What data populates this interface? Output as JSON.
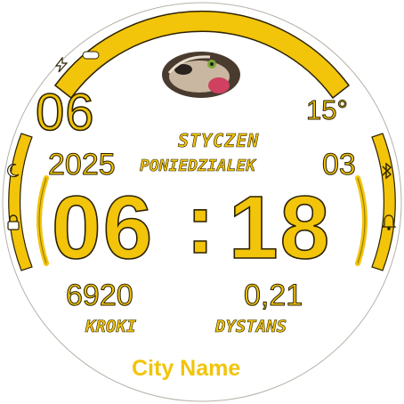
{
  "colors": {
    "accent": "#F2C40A",
    "outline": "#2b2200",
    "background": "#ffffff"
  },
  "date": {
    "day": "06",
    "year": "2025",
    "month_name": "STYCZEN",
    "weekday_name": "PONIEDZIALEK",
    "week_number": "03"
  },
  "weather": {
    "temperature": "15°"
  },
  "time": {
    "hours": "06",
    "separator": ":",
    "minutes": "18"
  },
  "activity": {
    "steps_value": "6920",
    "steps_label": "KROKI",
    "distance_value": "0,21",
    "distance_label": "DYSTANS"
  },
  "location": {
    "city": "City Name"
  },
  "icons": {
    "top_left": "charging-bolt-icon",
    "left_upper": "moon-icon",
    "left_lower": "lock-icon",
    "right_upper": "bluetooth-icon",
    "right_lower": "alarm-bell-icon",
    "top_center": "cat-photo"
  }
}
